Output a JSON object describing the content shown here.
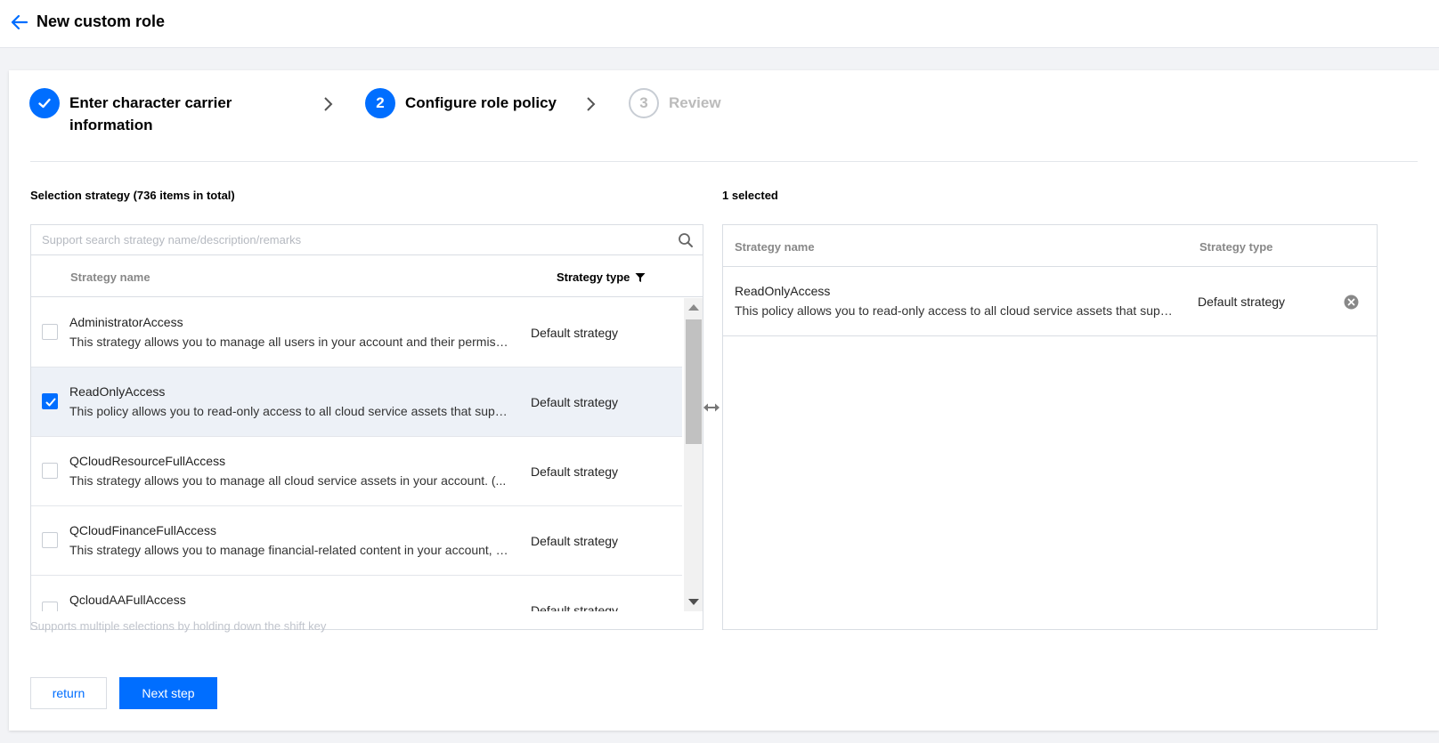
{
  "header": {
    "title": "New custom role"
  },
  "steps": [
    {
      "label": "Enter character carrier information",
      "state": "done"
    },
    {
      "number": "2",
      "label": "Configure role policy",
      "state": "active"
    },
    {
      "number": "3",
      "label": "Review",
      "state": "todo"
    }
  ],
  "left": {
    "title": "Selection strategy (736 items in total)",
    "search_placeholder": "Support search strategy name/description/remarks",
    "col_name": "Strategy name",
    "col_type": "Strategy type",
    "rows": [
      {
        "name": "AdministratorAccess",
        "desc": "This strategy allows you to manage all users in your account and their permissions, financial information, and cloud service assets.",
        "type": "Default strategy",
        "checked": false
      },
      {
        "name": "ReadOnlyAccess",
        "desc": "This policy allows you to read-only access to all cloud service assets that support interface level authentication.",
        "type": "Default strategy",
        "checked": true
      },
      {
        "name": "QCloudResourceFullAccess",
        "desc": "This strategy allows you to manage all cloud service assets in your account. (...",
        "type": "Default strategy",
        "checked": false
      },
      {
        "name": "QCloudFinanceFullAccess",
        "desc": "This strategy allows you to manage financial-related content in your account, such as payment and billing.",
        "type": "Default strategy",
        "checked": false
      },
      {
        "name": "QcloudAAFullAccess",
        "desc": "",
        "type": "Default strategy",
        "checked": false
      }
    ],
    "hint": "Supports multiple selections by holding down the shift key"
  },
  "right": {
    "title": "1 selected",
    "col_name": "Strategy name",
    "col_type": "Strategy type",
    "rows": [
      {
        "name": "ReadOnlyAccess",
        "desc": "This policy allows you to read-only access to all cloud service assets that support interface level authentication.",
        "type": "Default strategy"
      }
    ]
  },
  "buttons": {
    "return": "return",
    "next": "Next step"
  },
  "colors": {
    "primary": "#006eff",
    "selected_row": "#edf1f7",
    "border": "#d9dde3"
  },
  "icons": [
    "arrow-left-icon",
    "check-icon",
    "chevron-right-icon",
    "search-icon",
    "filter-icon",
    "swap-horizontal-icon",
    "close-circle-icon"
  ]
}
